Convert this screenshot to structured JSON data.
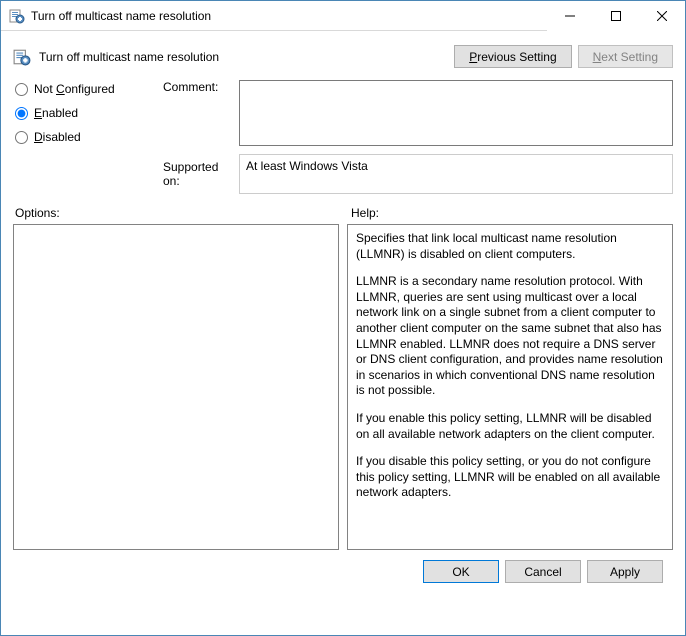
{
  "window": {
    "title": "Turn off multicast name resolution"
  },
  "header": {
    "policy_title": "Turn off multicast name resolution",
    "prev_label_pre": "",
    "prev_mnemonic": "P",
    "prev_label_post": "revious Setting",
    "next_label_pre": "",
    "next_mnemonic": "N",
    "next_label_post": "ext Setting"
  },
  "state": {
    "not_configured_pre": "Not ",
    "not_configured_mn": "C",
    "not_configured_post": "onfigured",
    "enabled_mn": "E",
    "enabled_post": "nabled",
    "disabled_mn": "D",
    "disabled_post": "isabled",
    "selected": "enabled"
  },
  "fields": {
    "comment_label": "Comment:",
    "comment_value": "",
    "supported_label": "Supported on:",
    "supported_value": "At least Windows Vista"
  },
  "panels": {
    "options_label": "Options:",
    "help_label": "Help:",
    "help_p1": "Specifies that link local multicast name resolution (LLMNR) is disabled on client computers.",
    "help_p2": "LLMNR is a secondary name resolution protocol. With LLMNR, queries are sent using multicast over a local network link on a single subnet from a client computer to another client computer on the same subnet that also has LLMNR enabled. LLMNR does not require a DNS server or DNS client configuration, and provides name resolution in scenarios in which conventional DNS name resolution is not possible.",
    "help_p3": "If you enable this policy setting, LLMNR will be disabled on all available network adapters on the client computer.",
    "help_p4": "If you disable this policy setting, or you do not configure this policy setting, LLMNR will be enabled on all available network adapters."
  },
  "footer": {
    "ok": "OK",
    "cancel": "Cancel",
    "apply": "Apply"
  }
}
